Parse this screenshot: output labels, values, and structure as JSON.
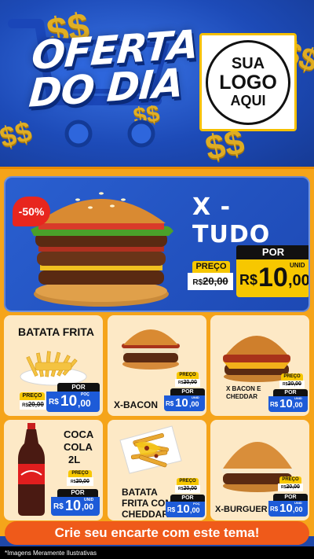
{
  "header": {
    "title_line1": "OFERTA",
    "title_line2": "DO DIA",
    "logo_line1": "SUA",
    "logo_line2": "LOGO",
    "logo_line3": "AQUI",
    "dollar_sign": "$$"
  },
  "featured": {
    "name": "X - TUDO",
    "discount_badge": "-50%",
    "preco_label": "PREÇO",
    "old_currency": "R$",
    "old_price": "20,00",
    "por_label": "POR",
    "new_currency": "R$",
    "new_int": "10",
    "new_dec": ",00",
    "unit": "UNID"
  },
  "products": [
    {
      "name": "BATATA FRITA",
      "preco_label": "PREÇO",
      "old_currency": "R$",
      "old_price": "20,00",
      "por_label": "POR",
      "new_currency": "R$",
      "new_int": "10",
      "new_dec": ",00",
      "unit": "POÇ"
    },
    {
      "name": "X-BACON",
      "preco_label": "PREÇO",
      "old_currency": "R$",
      "old_price": "20,00",
      "por_label": "POR",
      "new_currency": "R$",
      "new_int": "10",
      "new_dec": ",00",
      "unit": "UNID"
    },
    {
      "name_l1": "X BACON E",
      "name_l2": "CHEDDAR",
      "preco_label": "PREÇO",
      "old_currency": "R$",
      "old_price": "20,00",
      "por_label": "POR",
      "new_currency": "R$",
      "new_int": "10",
      "new_dec": ",00",
      "unit": "UNID"
    },
    {
      "name_l1": "COCA",
      "name_l2": "COLA",
      "name_l3": "2L",
      "preco_label": "PREÇO",
      "old_currency": "R$",
      "old_price": "20,00",
      "por_label": "POR",
      "new_currency": "R$",
      "new_int": "10",
      "new_dec": ",00",
      "unit": "UNID"
    },
    {
      "name_l1": "BATATA",
      "name_l2": "FRITA COM",
      "name_l3": "CHEDDAR",
      "preco_label": "PREÇO",
      "old_currency": "R$",
      "old_price": "20,00",
      "por_label": "POR",
      "new_currency": "R$",
      "new_int": "10",
      "new_dec": ",00",
      "unit": "POÇ"
    },
    {
      "name": "X-BURGUER",
      "preco_label": "PREÇO",
      "old_currency": "R$",
      "old_price": "20,00",
      "por_label": "POR",
      "new_currency": "R$",
      "new_int": "10",
      "new_dec": ",00",
      "unit": "UNID"
    }
  ],
  "cta": "Crie seu encarte com este tema!",
  "disclaimer": "*Imagens Meramente Ilustrativas",
  "colors": {
    "header_blue": "#1d4bb8",
    "panel_orange": "#f5a41a",
    "card_cream": "#fde9c6",
    "price_yellow": "#f7c700",
    "price_blue": "#1d5bd8",
    "cta_orange": "#ef5a1a",
    "discount_red": "#e8261e"
  }
}
